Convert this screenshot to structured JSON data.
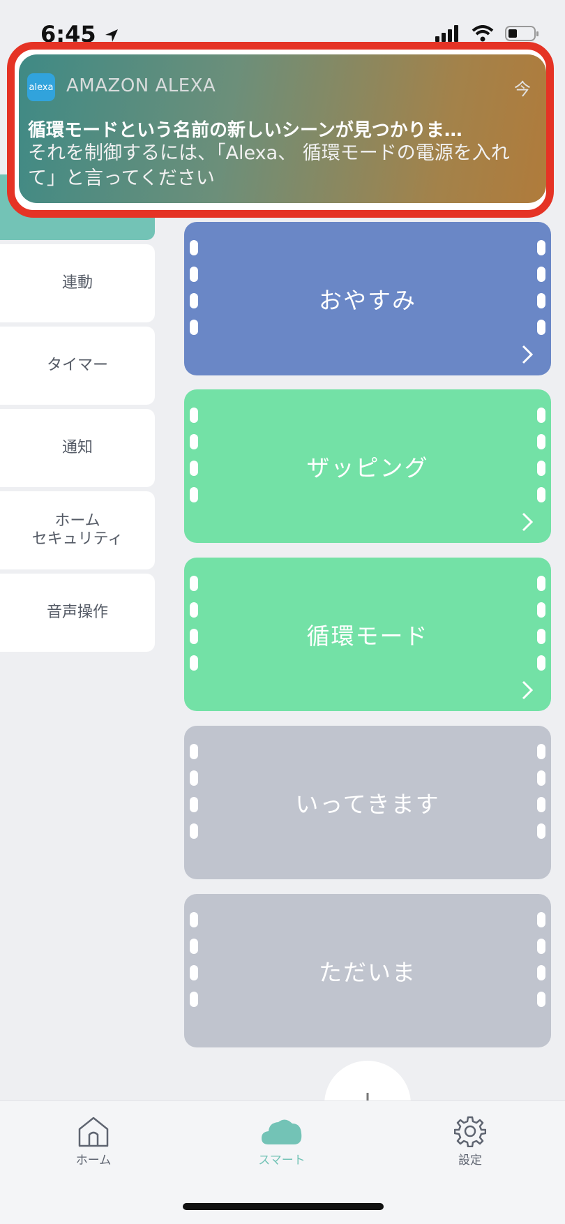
{
  "status_bar": {
    "time": "6:45"
  },
  "notification": {
    "app_icon_text": "alexa",
    "app_name": "AMAZON ALEXA",
    "time": "今",
    "title": "循環モードという名前の新しいシーンが見つかりま…",
    "body": "それを制御するには、「Alexa、 循環モードの電源を入れて」と言ってください"
  },
  "side_menu": {
    "items": [
      {
        "label": "連動"
      },
      {
        "label": "タイマー"
      },
      {
        "label": "通知"
      },
      {
        "label": "ホーム\nセキュリティ"
      },
      {
        "label": "音声操作"
      }
    ]
  },
  "scenes": [
    {
      "label": "おやすみ",
      "color": "#6a87c6"
    },
    {
      "label": "ザッピング",
      "color": "#73e1a6"
    },
    {
      "label": "循環モード",
      "color": "#73e1a6"
    },
    {
      "label": "いってきます",
      "color": "#c0c4ce"
    },
    {
      "label": "ただいま",
      "color": "#c0c4ce"
    }
  ],
  "tab_bar": {
    "tabs": [
      {
        "label": "ホーム",
        "icon": "house-icon"
      },
      {
        "label": "スマート",
        "icon": "cloud-icon",
        "active": true
      },
      {
        "label": "設定",
        "icon": "gear-icon"
      }
    ]
  },
  "colors": {
    "accent": "#73c3b6",
    "highlight_outline": "#e53325"
  }
}
